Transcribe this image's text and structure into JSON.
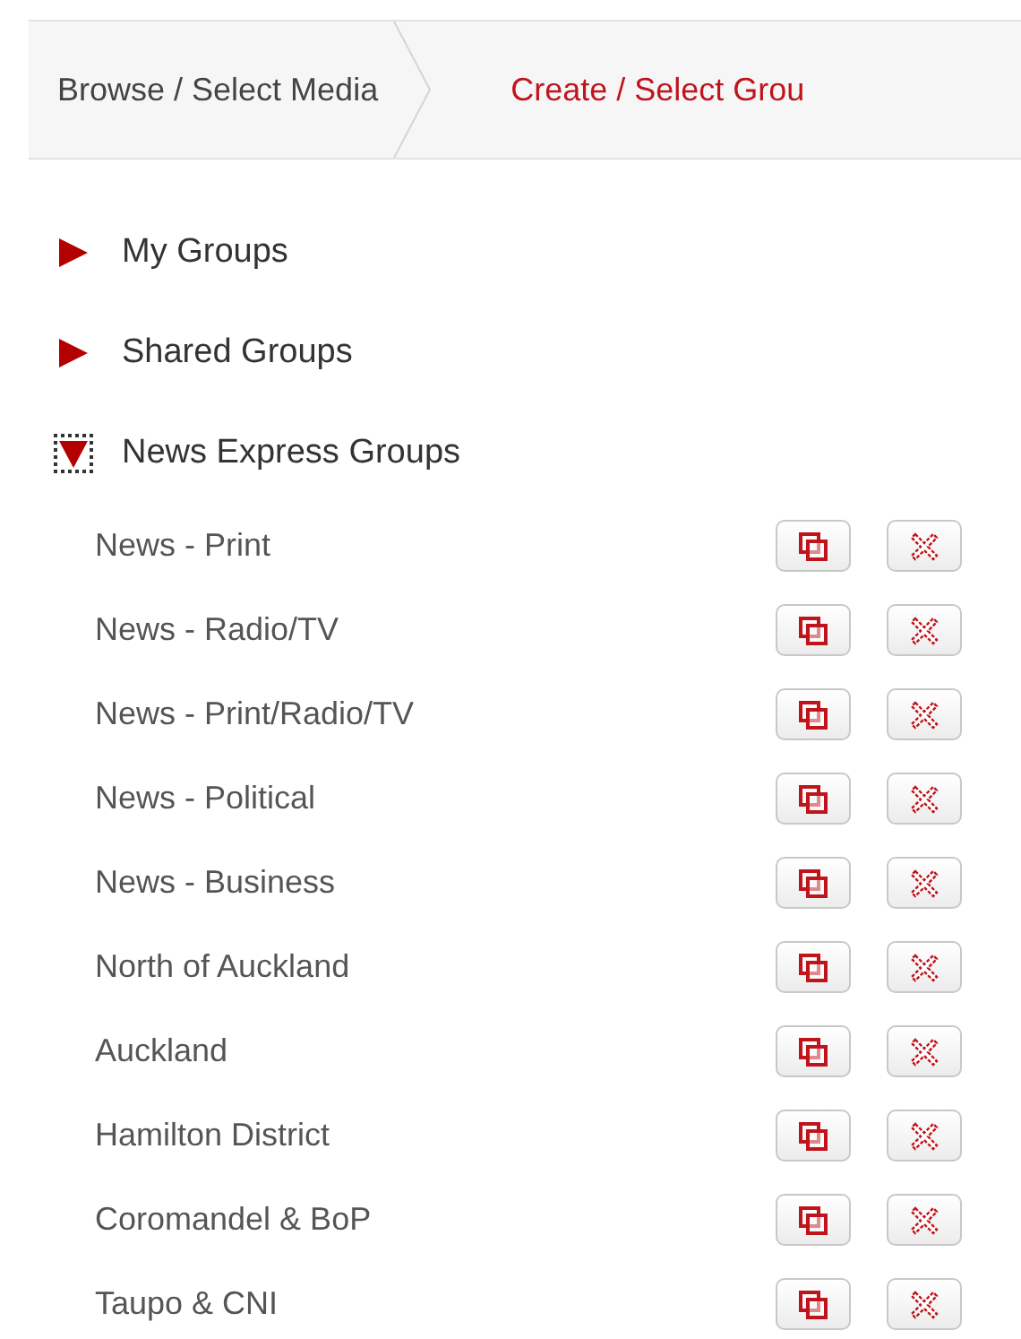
{
  "breadcrumb": [
    {
      "label": "Browse / Select Media",
      "selected": false
    },
    {
      "label": "Create / Select Grou",
      "selected": true
    }
  ],
  "groups": [
    {
      "label": "My Groups",
      "expanded": false,
      "focused": false
    },
    {
      "label": "Shared Groups",
      "expanded": false,
      "focused": false
    },
    {
      "label": "News Express Groups",
      "expanded": true,
      "focused": true,
      "children": [
        {
          "label": "News - Print"
        },
        {
          "label": "News - Radio/TV"
        },
        {
          "label": "News - Print/Radio/TV"
        },
        {
          "label": "News - Political"
        },
        {
          "label": "News - Business"
        },
        {
          "label": "North of Auckland"
        },
        {
          "label": "Auckland"
        },
        {
          "label": "Hamilton District"
        },
        {
          "label": "Coromandel & BoP"
        },
        {
          "label": "Taupo & CNI"
        }
      ]
    }
  ]
}
